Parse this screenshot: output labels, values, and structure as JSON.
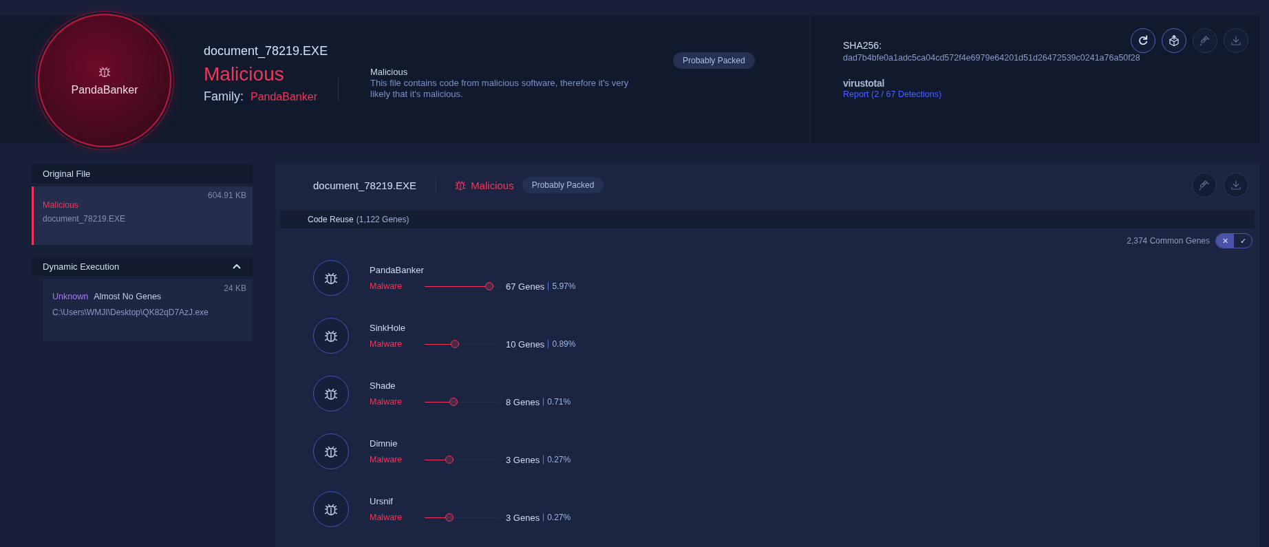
{
  "summary": {
    "family_badge": "PandaBanker",
    "file_name": "document_78219.EXE",
    "verdict": "Malicious",
    "family_label": "Family:",
    "family": "PandaBanker",
    "description_title": "Malicious",
    "description": "This file contains code from malicious software, therefore it's very likely that it's malicious.",
    "badge": "Probably Packed",
    "sha_label": "SHA256:",
    "sha": "dad7b4bfe0a1adc5ca04cd572f4e6979e64201d51d26472539c0241a76a50f28",
    "vt_label": "virustotal",
    "vt_link": "Report (2 / 67 Detections)",
    "actions": [
      {
        "kind": "refresh",
        "disabled": false
      },
      {
        "kind": "upload",
        "disabled": false
      },
      {
        "kind": "syringe",
        "disabled": true
      },
      {
        "kind": "download",
        "disabled": true
      }
    ]
  },
  "sidebar": {
    "original": {
      "title": "Original File",
      "selected": true,
      "size": "604.91 KB",
      "verdict": "Malicious",
      "name": "document_78219.EXE"
    },
    "dynamic": {
      "title": "Dynamic Execution",
      "expanded": true,
      "size": "24 KB",
      "verdict": "Unknown",
      "note": "Almost No Genes",
      "path": "C:\\Users\\WMJI\\Desktop\\QK82qD7AzJ.exe"
    }
  },
  "main": {
    "file_name": "document_78219.EXE",
    "verdict": "Malicious",
    "badge": "Probably Packed",
    "actions": [
      {
        "kind": "syringe",
        "disabled": true
      },
      {
        "kind": "download",
        "disabled": true
      }
    ],
    "section_title": "Code Reuse",
    "section_count": "(1,122 Genes)",
    "common_genes": "2,374 Common Genes",
    "toggle": [
      {
        "label": "✕",
        "selected": true
      },
      {
        "label": "✓",
        "selected": false
      }
    ],
    "genes": [
      {
        "name": "PandaBanker",
        "type": "Malware",
        "level": 0.85,
        "genes": "67 Genes",
        "percent": "5.97%"
      },
      {
        "name": "SinkHole",
        "type": "Malware",
        "level": 0.4,
        "genes": "10 Genes",
        "percent": "0.89%"
      },
      {
        "name": "Shade",
        "type": "Malware",
        "level": 0.38,
        "genes": "8 Genes",
        "percent": "0.71%"
      },
      {
        "name": "Dimnie",
        "type": "Malware",
        "level": 0.33,
        "genes": "3 Genes",
        "percent": "0.27%"
      },
      {
        "name": "Ursnif",
        "type": "Malware",
        "level": 0.33,
        "genes": "3 Genes",
        "percent": "0.27%"
      }
    ]
  }
}
